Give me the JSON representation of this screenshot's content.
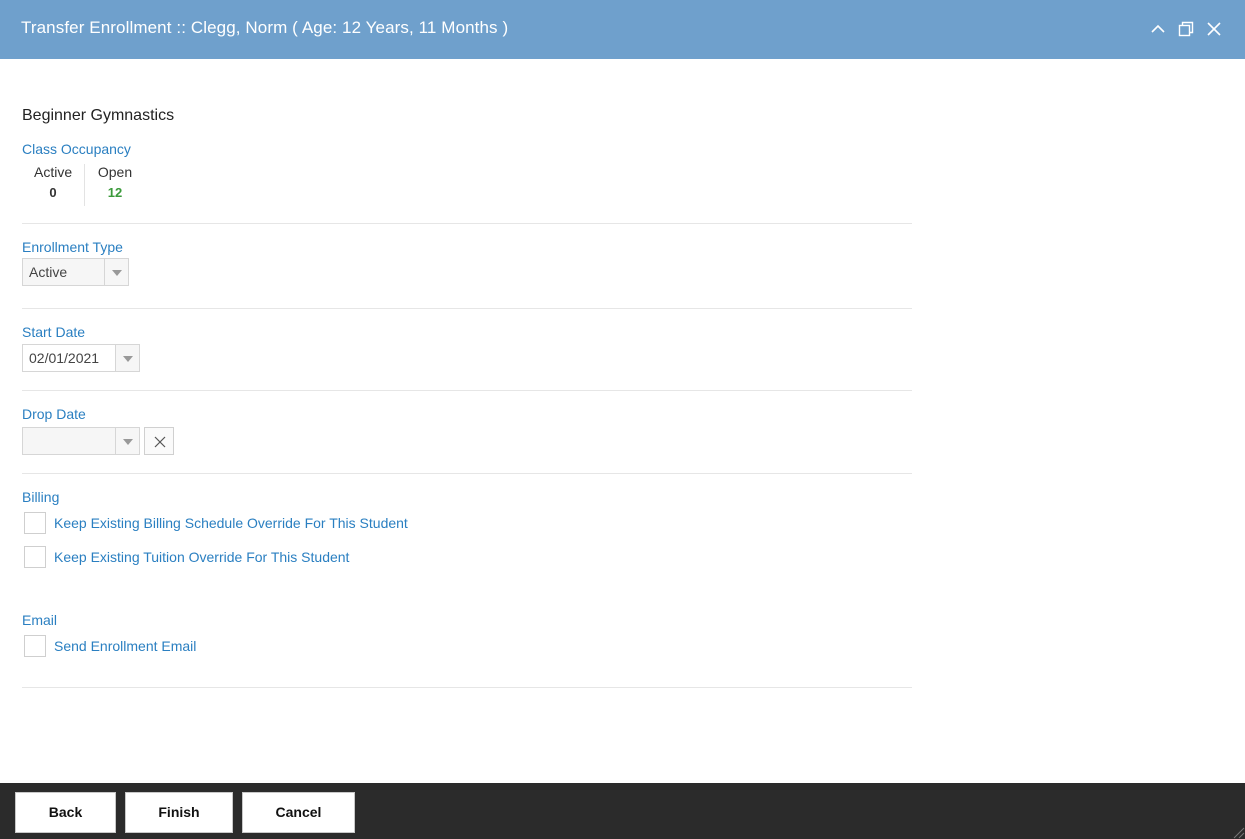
{
  "window": {
    "title": "Transfer Enrollment :: Clegg, Norm ( Age: 12 Years, 11 Months )",
    "controls": [
      "chevron-up-icon",
      "maximize-icon",
      "close-icon"
    ]
  },
  "class_name": "Beginner Gymnastics",
  "occupancy": {
    "label": "Class Occupancy",
    "active_label": "Active",
    "active_value": "0",
    "open_label": "Open",
    "open_value": "12",
    "open_color": "#3a9a3a"
  },
  "enrollment_type": {
    "label": "Enrollment Type",
    "value": "Active"
  },
  "start_date": {
    "label": "Start Date",
    "value": "02/01/2021"
  },
  "drop_date": {
    "label": "Drop Date",
    "value": ""
  },
  "billing": {
    "label": "Billing",
    "options": [
      {
        "label": "Keep Existing Billing Schedule Override For This Student",
        "checked": false
      },
      {
        "label": "Keep Existing Tuition Override For This Student",
        "checked": false
      }
    ]
  },
  "email": {
    "label": "Email",
    "option": {
      "label": "Send Enrollment Email",
      "checked": false
    }
  },
  "footer": {
    "back_label": "Back",
    "finish_label": "Finish",
    "cancel_label": "Cancel"
  },
  "colors": {
    "titlebar": "#6fa0cc",
    "accent": "#2a7fc1",
    "footer": "#2b2b2b"
  }
}
